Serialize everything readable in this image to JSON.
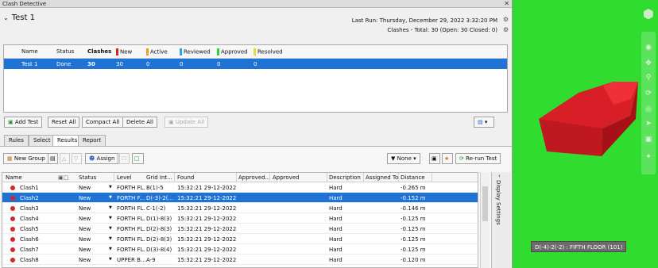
{
  "window": {
    "title": "Clash Detective",
    "close_glyph": "✕"
  },
  "test_header": {
    "name": "Test 1",
    "last_run": "Last Run:  Thursday, December 29, 2022 3:32:20 PM",
    "summary": "Clashes - Total:  30  (Open:  30  Closed:  0)"
  },
  "tests_table": {
    "columns": [
      {
        "label": "Name"
      },
      {
        "label": "Status"
      },
      {
        "label": "Clashes"
      },
      {
        "label": "New",
        "color": "#e02020"
      },
      {
        "label": "Active",
        "color": "#f39a22"
      },
      {
        "label": "Reviewed",
        "color": "#28a8e8"
      },
      {
        "label": "Approved",
        "color": "#2fcf3a"
      },
      {
        "label": "Resolved",
        "color": "#f2d531"
      }
    ],
    "row": [
      "Test 1",
      "Done",
      "30",
      "30",
      "0",
      "0",
      "0",
      "0"
    ]
  },
  "test_buttons": {
    "add": "Add Test",
    "reset": "Reset All",
    "compact": "Compact All",
    "delete": "Delete All",
    "update": "Update All"
  },
  "tabs": [
    "Rules",
    "Select",
    "Results",
    "Report"
  ],
  "active_tab": "Results",
  "toolbar": {
    "new_group": "New Group",
    "assign": "Assign",
    "none": "None",
    "rerun": "Re-run Test"
  },
  "results": {
    "columns": [
      "Name",
      "Status",
      "Level",
      "Grid Int...",
      "Found",
      "Approved...",
      "Approved",
      "Description",
      "Assigned To",
      "Distance"
    ],
    "rows": [
      {
        "name": "Clash1",
        "status": "New",
        "level": "FORTH FL...",
        "grid": "B(1)-5",
        "found": "15:32:21 29-12-2022",
        "desc": "Hard",
        "dist": "-0.265 m"
      },
      {
        "name": "Clash2",
        "status": "New",
        "level": "FORTH F...",
        "grid": "D(-3)-2(...",
        "found": "15:32:21 29-12-2022",
        "desc": "Hard",
        "dist": "-0.152 m",
        "selected": true
      },
      {
        "name": "Clash3",
        "status": "New",
        "level": "FORTH FL...",
        "grid": "C-1(-2)",
        "found": "15:32:21 29-12-2022",
        "desc": "Hard",
        "dist": "-0.146 m"
      },
      {
        "name": "Clash4",
        "status": "New",
        "level": "FORTH FL...",
        "grid": "D(1)-8(3)",
        "found": "15:32:21 29-12-2022",
        "desc": "Hard",
        "dist": "-0.125 m"
      },
      {
        "name": "Clash5",
        "status": "New",
        "level": "FORTH FL...",
        "grid": "D(2)-8(3)",
        "found": "15:32:21 29-12-2022",
        "desc": "Hard",
        "dist": "-0.125 m"
      },
      {
        "name": "Clash6",
        "status": "New",
        "level": "FORTH FL...",
        "grid": "D(2)-8(3)",
        "found": "15:32:21 29-12-2022",
        "desc": "Hard",
        "dist": "-0.125 m"
      },
      {
        "name": "Clash7",
        "status": "New",
        "level": "FORTH FL...",
        "grid": "D(3)-8(4)",
        "found": "15:32:21 29-12-2022",
        "desc": "Hard",
        "dist": "-0.125 m"
      },
      {
        "name": "Clash8",
        "status": "New",
        "level": "UPPER B...",
        "grid": "A-9",
        "found": "15:32:21 29-12-2022",
        "desc": "Hard",
        "dist": "-0.120 m"
      }
    ]
  },
  "display_settings": "Display Settings",
  "viewport": {
    "tooltip": "D(-4)-2(-2) : FIFTH FLOOR (101)",
    "background": "#2fdc2f",
    "object_color": "#e8222a"
  }
}
